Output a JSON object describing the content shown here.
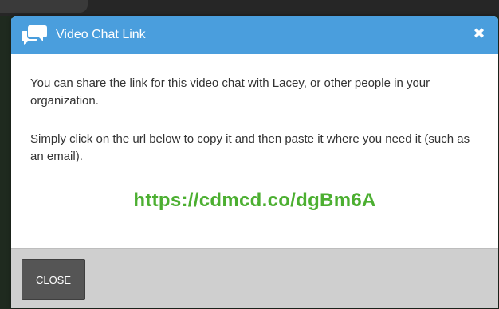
{
  "dialog": {
    "title": "Video Chat Link",
    "header_icon": "chat-bubbles-icon",
    "close_icon_glyph": "✖",
    "header_color": "#4a9edd"
  },
  "body": {
    "paragraph_1": "You can share the link for this video chat with Lacey, or other people in your organization.",
    "paragraph_2": "Simply click on the url below to copy it and then paste it where you need it (such as an email).",
    "link": "https://cdmcd.co/dgBm6A",
    "link_color": "#4caf31"
  },
  "footer": {
    "close_label": "CLOSE"
  }
}
